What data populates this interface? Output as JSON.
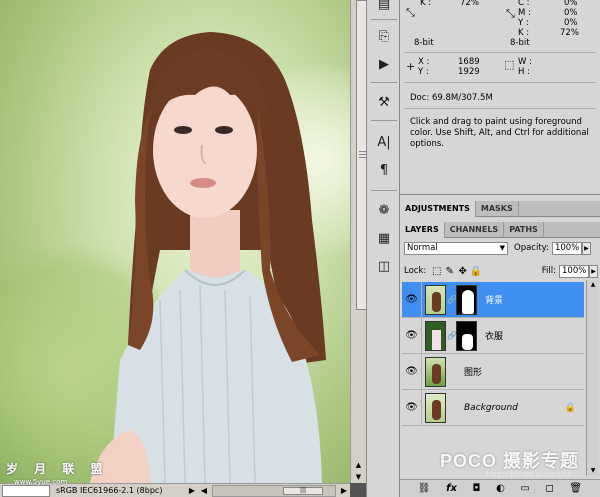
{
  "info_panel": {
    "rows": [
      {
        "left": "K :       72%",
        "right": "C :\t0%"
      },
      {
        "left": "",
        "right": "M :\t0%"
      },
      {
        "left": "",
        "right": "Y :\t0%"
      },
      {
        "left": "",
        "right": "K :\t72%"
      },
      {
        "left": "8-bit",
        "right": "8-bit"
      }
    ],
    "cmyk_right": {
      "c": "0%",
      "m": "0%",
      "y": "0%",
      "k": "72%"
    },
    "k_left": "72%",
    "bits_left": "8-bit",
    "bits_right": "8-bit",
    "x_label": "X :",
    "x_value": "1689",
    "y_label": "Y :",
    "y_value": "1929",
    "w_label": "W :",
    "h_label": "H :",
    "doc_size": "Doc: 69.8M/307.5M",
    "hint": "Click and drag to paint using foreground color.  Use Shift, Alt, and Ctrl for additional options."
  },
  "adjust_tabs": [
    "ADJUSTMENTS",
    "MASKS"
  ],
  "layer_tabs": [
    "LAYERS",
    "CHANNELS",
    "PATHS"
  ],
  "blend_mode": "Normal",
  "opacity_label": "Opacity:",
  "opacity_value": "100%",
  "lock_label": "Lock:",
  "fill_label": "Fill:",
  "fill_value": "100%",
  "layers": [
    {
      "name": "背景",
      "selected": true,
      "italic": false,
      "has_mask": true
    },
    {
      "name": "衣服",
      "selected": false,
      "italic": false,
      "has_mask": true
    },
    {
      "name": "图形",
      "selected": false,
      "italic": false,
      "has_mask": false
    },
    {
      "name": "Background",
      "selected": false,
      "italic": true,
      "has_mask": false
    }
  ],
  "status_bar": {
    "zoom": "",
    "info": "sRGB IEC61966-2.1 (8bpc)"
  },
  "watermark_left": "岁 月 联 盟",
  "watermark_left_url": "www.5yue.com",
  "watermark_poco": "POCO 摄影专题",
  "watermark_poco_url": "http://photo.poco.cn/",
  "colors": {
    "panel_bg": "#d6d6d6",
    "selected_layer": "#3f8ff0",
    "tab_bg": "#bdbdbd"
  }
}
